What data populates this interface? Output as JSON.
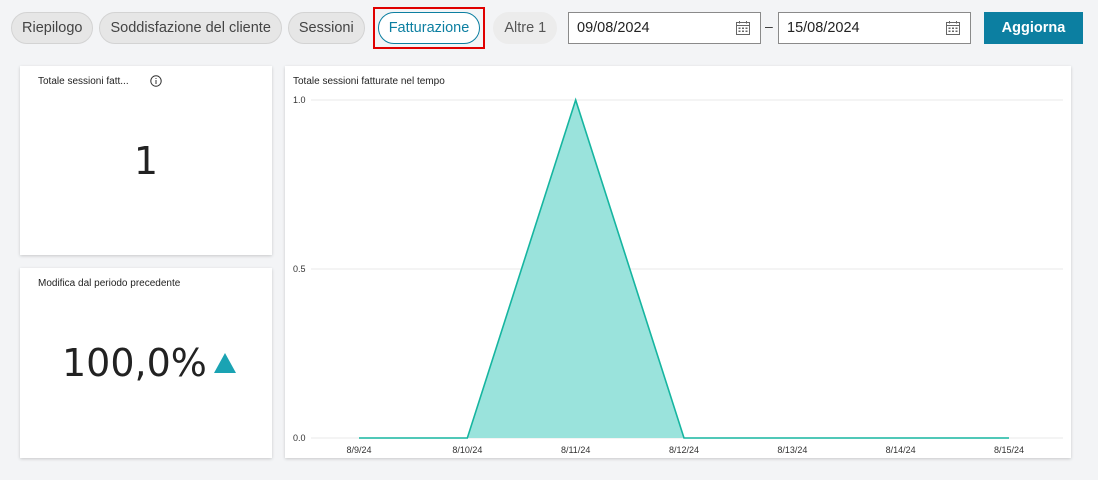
{
  "tabs": [
    {
      "label": "Riepilogo",
      "active": false
    },
    {
      "label": "Soddisfazione del cliente",
      "active": false
    },
    {
      "label": "Sessioni",
      "active": false
    },
    {
      "label": "Fatturazione",
      "active": true
    },
    {
      "label": "Altre 1",
      "active": false
    }
  ],
  "date_range": {
    "start": "09/08/2024",
    "separator": "–",
    "end": "15/08/2024"
  },
  "refresh_label": "Aggiorna",
  "kpi_total": {
    "title": "Totale sessioni fatt...",
    "value": "1"
  },
  "kpi_change": {
    "title": "Modifica dal periodo precedente",
    "value": "100,0%",
    "trend": "up"
  },
  "colors": {
    "accent": "#0c7fa1",
    "area_fill": "#9ae3dc",
    "area_line": "#16b5a0",
    "trend_up": "#1aa3b3"
  },
  "chart_data": {
    "type": "area",
    "title": "Totale sessioni fatturate nel tempo",
    "x": [
      "8/9/24",
      "8/10/24",
      "8/11/24",
      "8/12/24",
      "8/13/24",
      "8/14/24",
      "8/15/24"
    ],
    "values": [
      0,
      0,
      1,
      0,
      0,
      0,
      0
    ],
    "y_ticks": [
      "0.0",
      "0.5",
      "1.0"
    ],
    "ylim": [
      0,
      1
    ],
    "grid": true
  }
}
